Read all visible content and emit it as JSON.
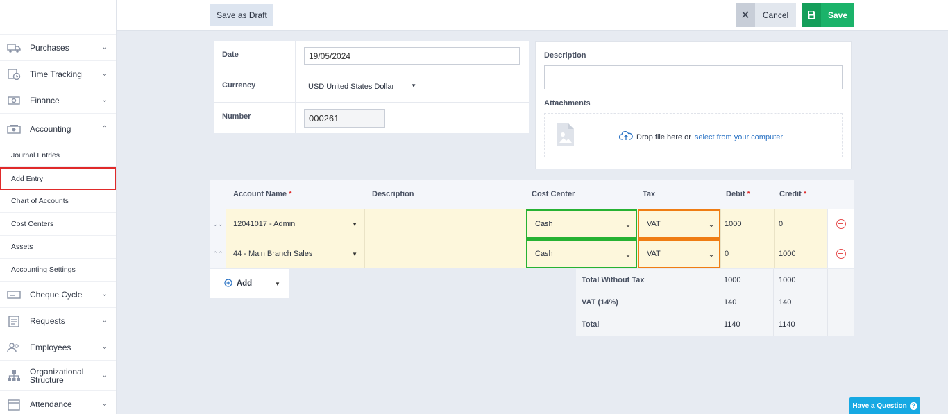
{
  "sidebar": {
    "items_top": [
      {
        "label": "Purchases",
        "icon": "truck-icon"
      },
      {
        "label": "Time Tracking",
        "icon": "clock-calendar-icon"
      },
      {
        "label": "Finance",
        "icon": "money-icon"
      }
    ],
    "accounting": {
      "label": "Accounting",
      "icon": "accounting-icon"
    },
    "sub_items": [
      "Journal Entries",
      "Add Entry",
      "Chart of Accounts",
      "Cost Centers",
      "Assets",
      "Accounting Settings"
    ],
    "items_bottom": [
      {
        "label": "Cheque Cycle",
        "icon": "cheque-icon"
      },
      {
        "label": "Requests",
        "icon": "clipboard-icon"
      },
      {
        "label": "Employees",
        "icon": "users-icon"
      },
      {
        "label": "Organizational Structure",
        "icon": "org-chart-icon"
      },
      {
        "label": "Attendance",
        "icon": "calendar-icon"
      }
    ]
  },
  "toolbar": {
    "draft_label": "Save as Draft",
    "cancel_label": "Cancel",
    "save_label": "Save"
  },
  "form": {
    "date_label": "Date",
    "date_value": "19/05/2024",
    "currency_label": "Currency",
    "currency_value": "USD United States Dollar",
    "number_label": "Number",
    "number_value": "000261"
  },
  "side_panel": {
    "description_label": "Description",
    "attachments_label": "Attachments",
    "drop_text": "Drop file here or",
    "drop_link": "select from your computer"
  },
  "table": {
    "headers": {
      "account_name": "Account Name",
      "description": "Description",
      "cost_center": "Cost Center",
      "tax": "Tax",
      "debit": "Debit",
      "credit": "Credit",
      "required_mark": "*"
    },
    "rows": [
      {
        "account": "12041017 - Admin",
        "description": "",
        "cost_center": "Cash",
        "tax": "VAT",
        "debit": "1000",
        "credit": "0"
      },
      {
        "account": "44 - Main Branch Sales",
        "description": "",
        "cost_center": "Cash",
        "tax": "VAT",
        "debit": "0",
        "credit": "1000"
      }
    ],
    "add_label": "Add"
  },
  "totals": [
    {
      "label": "Total Without Tax",
      "debit": "1000",
      "credit": "1000"
    },
    {
      "label": "VAT (14%)",
      "debit": "140",
      "credit": "140"
    },
    {
      "label": "Total",
      "debit": "1140",
      "credit": "1140"
    }
  ],
  "help_label": "Have a Question",
  "colors": {
    "save_green": "#1bb36a",
    "cost_center_border": "#27b233",
    "tax_border": "#ef7d14",
    "active_item_border": "#e02a2a",
    "link": "#2b73c4",
    "help": "#16a9e3"
  }
}
